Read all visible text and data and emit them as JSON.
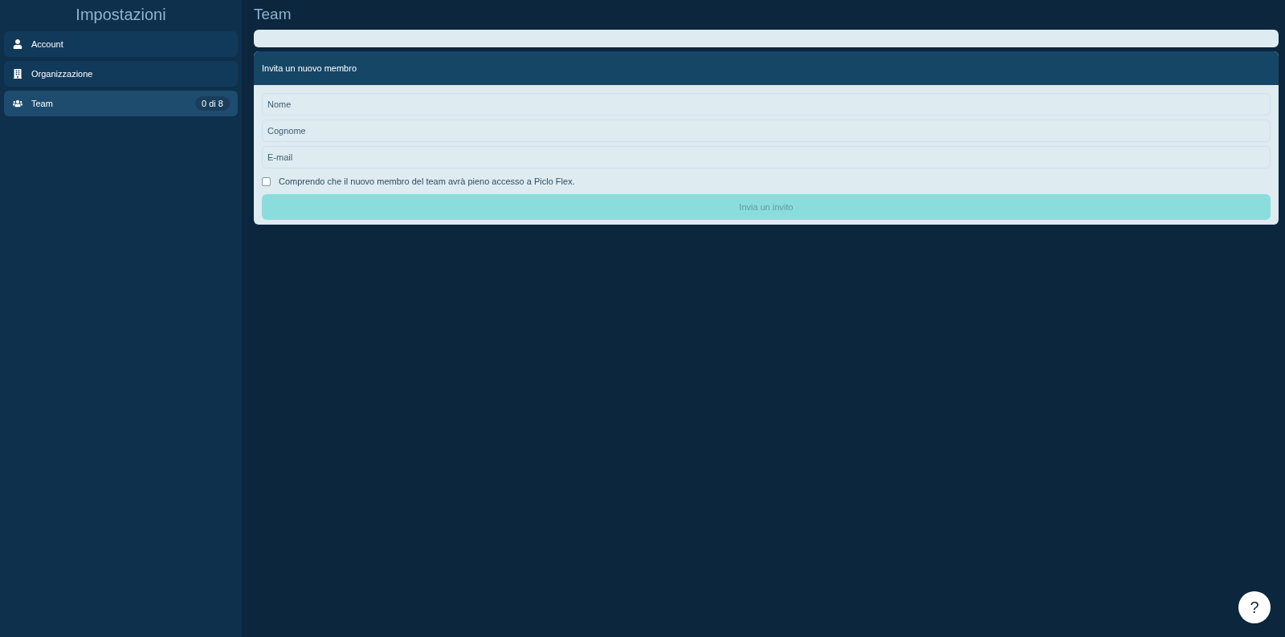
{
  "sidebar": {
    "title": "Impostazioni",
    "items": [
      {
        "kind": "user",
        "label": "Account",
        "selected": false
      },
      {
        "kind": "building",
        "label": "Organizzazione",
        "selected": false
      },
      {
        "kind": "team",
        "label": "Team",
        "selected": true,
        "badge": "0 di 8"
      }
    ]
  },
  "page": {
    "title": "Team"
  },
  "invite": {
    "title": "Invita un nuovo membro",
    "fields": [
      {
        "placeholder": "Nome"
      },
      {
        "placeholder": "Cognome"
      },
      {
        "placeholder": "E-mail"
      }
    ],
    "consent": {
      "label": "Comprendo che il nuovo membro del team avrà pieno accesso a Piclo Flex.",
      "checked": false
    },
    "submit": {
      "label": "Invia un invito",
      "disabled": true
    }
  },
  "help": {
    "label": "?"
  }
}
